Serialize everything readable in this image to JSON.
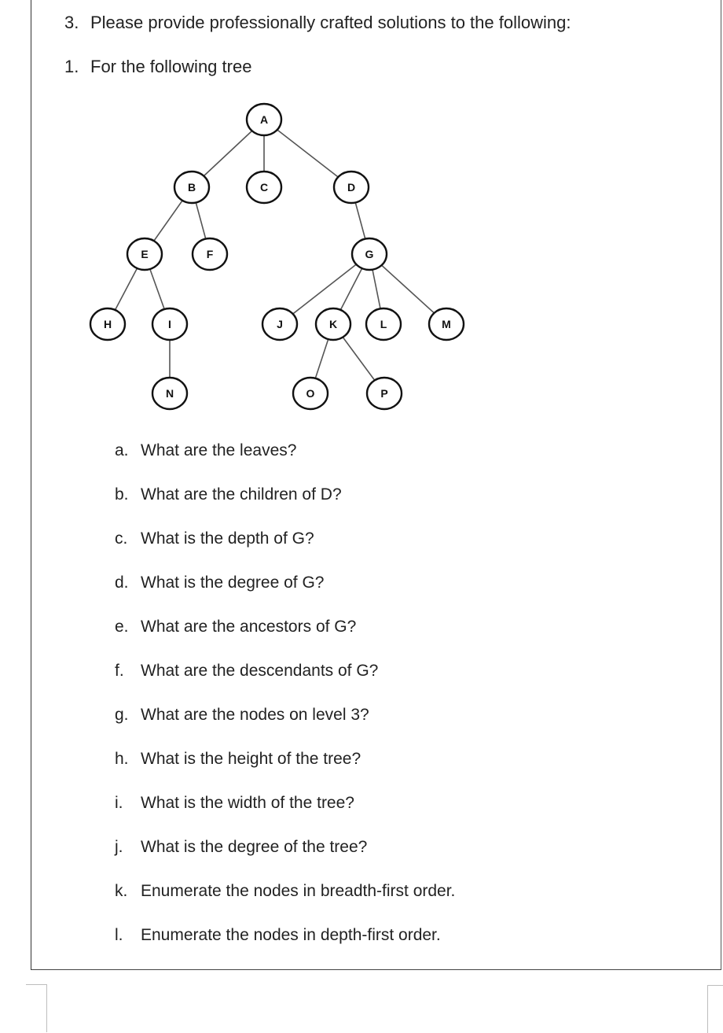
{
  "header": {
    "problem_number": "3.",
    "problem_text": "Please provide professionally crafted solutions to the following:",
    "sub_number": "1.",
    "sub_text": "For the following tree"
  },
  "tree": {
    "root": "A",
    "nodes": [
      "A",
      "B",
      "C",
      "D",
      "E",
      "F",
      "G",
      "H",
      "I",
      "J",
      "K",
      "L",
      "M",
      "N",
      "O",
      "P"
    ],
    "edges": [
      [
        "A",
        "B"
      ],
      [
        "A",
        "C"
      ],
      [
        "A",
        "D"
      ],
      [
        "B",
        "E"
      ],
      [
        "B",
        "F"
      ],
      [
        "D",
        "G"
      ],
      [
        "E",
        "H"
      ],
      [
        "E",
        "I"
      ],
      [
        "G",
        "J"
      ],
      [
        "G",
        "K"
      ],
      [
        "G",
        "L"
      ],
      [
        "G",
        "M"
      ],
      [
        "I",
        "N"
      ],
      [
        "K",
        "O"
      ],
      [
        "K",
        "P"
      ]
    ]
  },
  "questions": [
    {
      "letter": "a.",
      "text": "What are the leaves?"
    },
    {
      "letter": "b.",
      "text": "What are the children of D?"
    },
    {
      "letter": "c.",
      "text": "What is the depth of G?"
    },
    {
      "letter": "d.",
      "text": "What is the degree of G?"
    },
    {
      "letter": "e.",
      "text": "What are the ancestors of G?"
    },
    {
      "letter": "f.",
      "text": "What are the descendants of G?"
    },
    {
      "letter": "g.",
      "text": "What are the nodes on level 3?"
    },
    {
      "letter": "h.",
      "text": "What is the height of the tree?"
    },
    {
      "letter": "i.",
      "text": "What is the width of the tree?"
    },
    {
      "letter": "j.",
      "text": "What is the degree of the tree?"
    },
    {
      "letter": "k.",
      "text": "Enumerate the nodes in breadth-first order."
    },
    {
      "letter": "l.",
      "text": "Enumerate the nodes in depth-first order."
    }
  ]
}
